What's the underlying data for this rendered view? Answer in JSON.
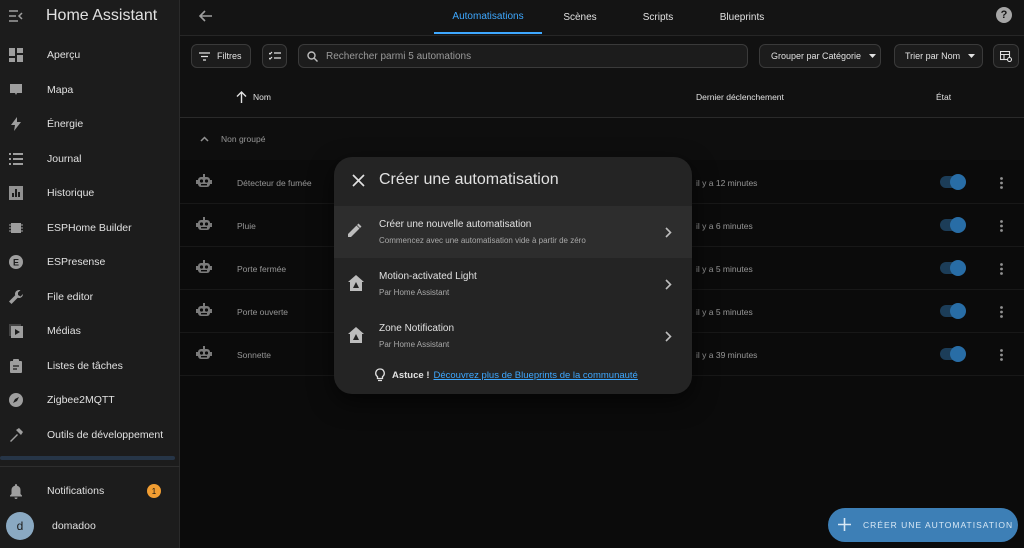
{
  "sidebar": {
    "title": "Home Assistant",
    "items": [
      {
        "label": "Aperçu",
        "icon": "dashboard-icon"
      },
      {
        "label": "Mapa",
        "icon": "map-marker-icon"
      },
      {
        "label": "Énergie",
        "icon": "lightning-icon"
      },
      {
        "label": "Journal",
        "icon": "list-icon"
      },
      {
        "label": "Historique",
        "icon": "chart-icon"
      },
      {
        "label": "ESPHome Builder",
        "icon": "chip-icon"
      },
      {
        "label": "ESPresense",
        "icon": "espresense-icon"
      },
      {
        "label": "File editor",
        "icon": "wrench-icon"
      },
      {
        "label": "Médias",
        "icon": "play-icon"
      },
      {
        "label": "Listes de tâches",
        "icon": "clipboard-icon"
      },
      {
        "label": "Zigbee2MQTT",
        "icon": "compass-icon"
      },
      {
        "label": "Outils de développement",
        "icon": "hammer-icon"
      }
    ],
    "notifications": {
      "label": "Notifications",
      "count": "1"
    },
    "user": {
      "initial": "d",
      "name": "domadoo"
    }
  },
  "topbar": {
    "tabs": [
      "Automatisations",
      "Scènes",
      "Scripts",
      "Blueprints"
    ],
    "help": "?"
  },
  "toolbar": {
    "filters": "Filtres",
    "search_placeholder": "Rechercher parmi 5 automations",
    "group_by": "Grouper par Catégorie",
    "sort_by": "Trier par Nom"
  },
  "table": {
    "col_name": "Nom",
    "col_last": "Dernier déclenchement",
    "col_state": "État",
    "group": "Non groupé",
    "rows": [
      {
        "name": "Détecteur de fumée",
        "last": "il y a 12 minutes",
        "enabled": true
      },
      {
        "name": "Pluie",
        "last": "il y a 6 minutes",
        "enabled": true
      },
      {
        "name": "Porte fermée",
        "last": "il y a 5 minutes",
        "enabled": true
      },
      {
        "name": "Porte ouverte",
        "last": "il y a 5 minutes",
        "enabled": true
      },
      {
        "name": "Sonnette",
        "last": "il y a 39 minutes",
        "enabled": true
      }
    ]
  },
  "dialog": {
    "title": "Créer une automatisation",
    "options": [
      {
        "title": "Créer une nouvelle automatisation",
        "subtitle": "Commencez avec une automatisation vide à partir de zéro",
        "icon": "pencil-icon"
      },
      {
        "title": "Motion-activated Light",
        "subtitle": "Par Home Assistant",
        "icon": "blueprint-icon"
      },
      {
        "title": "Zone Notification",
        "subtitle": "Par Home Assistant",
        "icon": "blueprint-icon"
      }
    ],
    "tip_label": "Astuce !",
    "tip_link": "Découvrez plus de Blueprints de la communauté"
  },
  "fab": {
    "label": "CRÉER UNE AUTOMATISATION"
  },
  "colors": {
    "accent": "#3ea8ff",
    "background": "#111111",
    "sidebar": "#1c1c1c",
    "badge": "#f19d32"
  }
}
